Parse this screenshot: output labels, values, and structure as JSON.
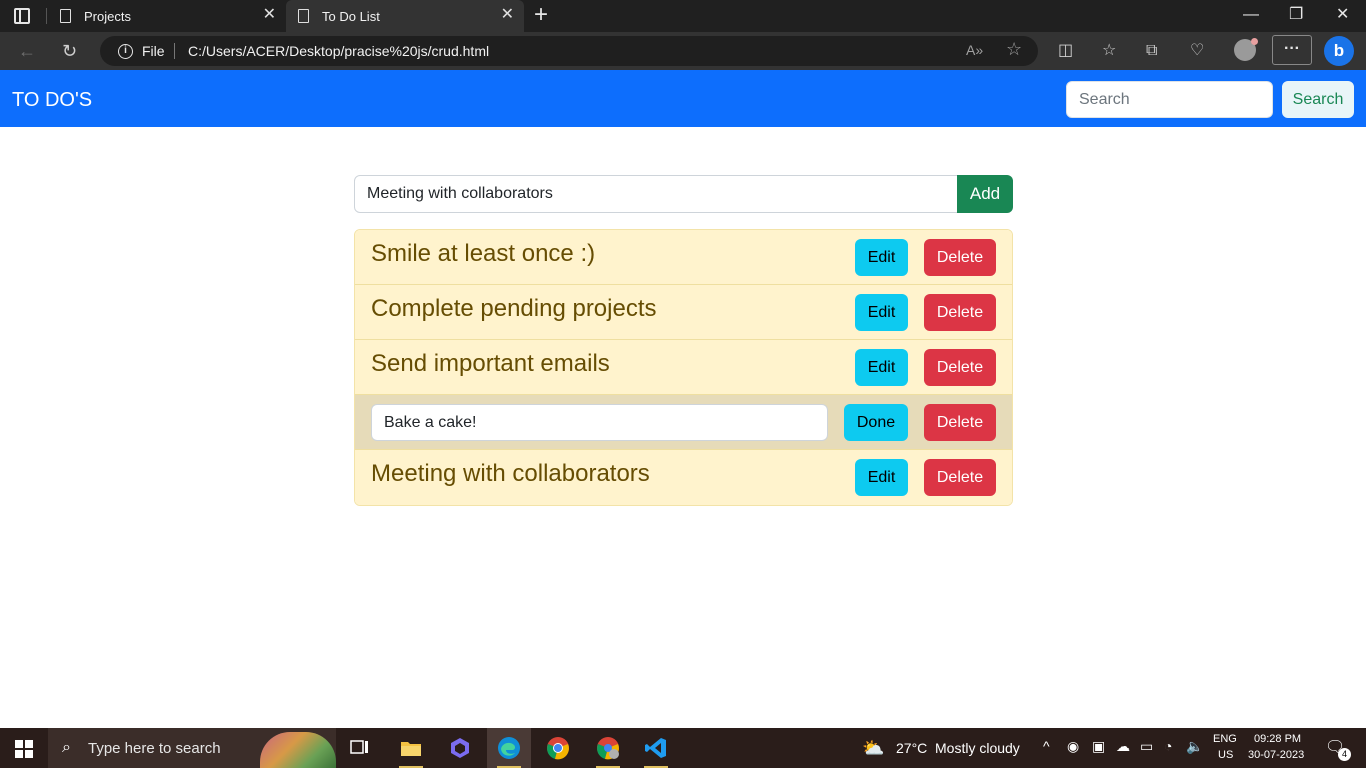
{
  "browser": {
    "tabs": [
      {
        "title": "Projects",
        "active": false
      },
      {
        "title": "To Do List",
        "active": true
      }
    ],
    "address": {
      "scheme_label": "File",
      "url": "C:/Users/ACER/Desktop/pracise%20js/crud.html"
    },
    "window_controls": {
      "minimize": "—",
      "maximize": "❐",
      "close": "✕"
    }
  },
  "navbar": {
    "brand": "TO DO'S",
    "search_placeholder": "Search",
    "search_button": "Search"
  },
  "add_form": {
    "input_value": "Meeting with collaborators",
    "add_button": "Add"
  },
  "todos": [
    {
      "text": "Smile at least once :)",
      "editing": false,
      "edit_label": "Edit",
      "delete_label": "Delete"
    },
    {
      "text": "Complete pending projects",
      "editing": false,
      "edit_label": "Edit",
      "delete_label": "Delete"
    },
    {
      "text": "Send important emails",
      "editing": false,
      "edit_label": "Edit",
      "delete_label": "Delete"
    },
    {
      "text": "Bake a cake!",
      "editing": true,
      "done_label": "Done",
      "delete_label": "Delete"
    },
    {
      "text": "Meeting with collaborators",
      "editing": false,
      "edit_label": "Edit",
      "delete_label": "Delete"
    }
  ],
  "taskbar": {
    "search_placeholder": "Type here to search",
    "weather": {
      "temp": "27°C",
      "condition": "Mostly cloudy"
    },
    "language": {
      "lang": "ENG",
      "region": "US"
    },
    "clock": {
      "time": "09:28 PM",
      "date": "30-07-2023"
    },
    "notification_count": "4"
  },
  "colors": {
    "navbar": "#0d6efd",
    "add_button": "#198754",
    "edit_button": "#0dcaf0",
    "delete_button": "#dc3545",
    "list_item_bg": "#fff3cd",
    "list_text": "#664d03"
  }
}
